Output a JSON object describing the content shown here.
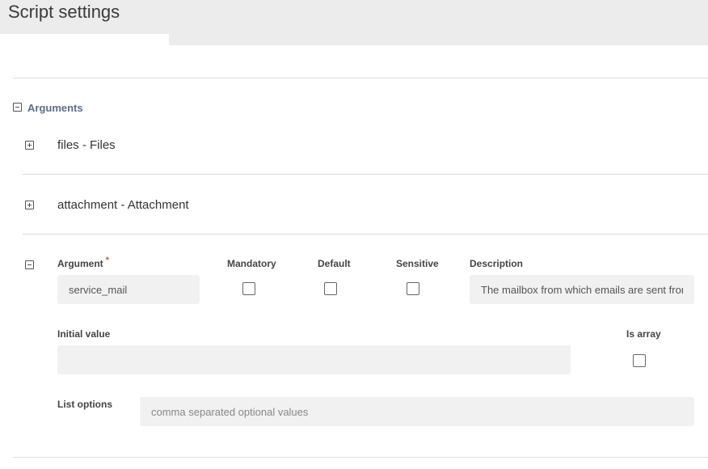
{
  "page": {
    "title": "Script settings"
  },
  "arguments_section": {
    "label": "Arguments"
  },
  "items": [
    {
      "label": "files - Files"
    },
    {
      "label": "attachment - Attachment"
    }
  ],
  "argument_form": {
    "argument_label": "Argument",
    "required_marker": "*",
    "argument_value": "service_mail",
    "mandatory_label": "Mandatory",
    "mandatory_checked": false,
    "default_label": "Default",
    "default_checked": false,
    "sensitive_label": "Sensitive",
    "sensitive_checked": false,
    "description_label": "Description",
    "description_value": "The mailbox from which emails are sent from",
    "initial_value_label": "Initial value",
    "initial_value": "",
    "is_array_label": "Is array",
    "is_array_checked": false,
    "list_options_label": "List options",
    "list_options_placeholder": "comma separated optional values",
    "list_options_value": ""
  }
}
